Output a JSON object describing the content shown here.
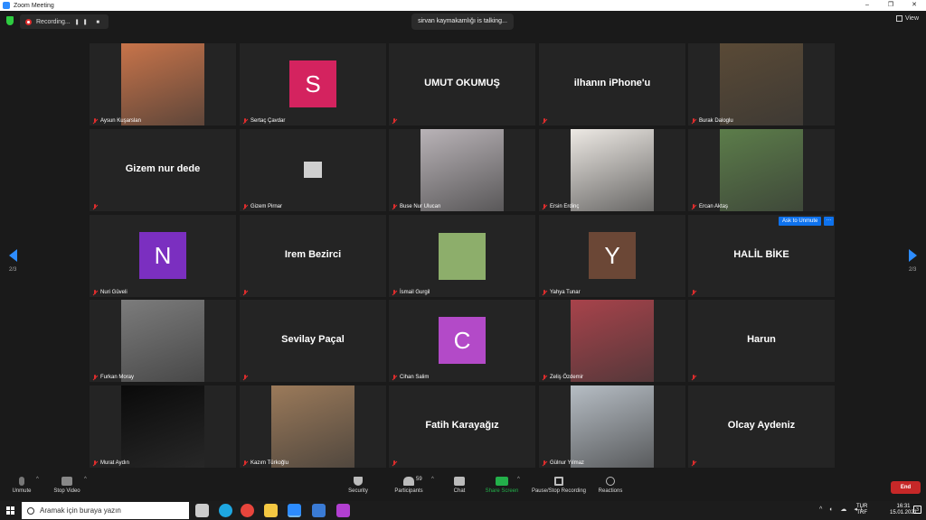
{
  "window": {
    "title": "Zoom Meeting",
    "controls": [
      "–",
      "❐",
      "✕"
    ]
  },
  "topbar": {
    "recording_label": "Recording...",
    "talking_label": "sirvan kaymakamlığı is talking...",
    "view_label": "View"
  },
  "tiles": [
    {
      "name": "Aysun Kuşarslan",
      "kind": "photo",
      "color": "#c8744a"
    },
    {
      "name": "Sertaç Çavdar",
      "kind": "avatar",
      "letter": "S",
      "color": "#d4235f"
    },
    {
      "name": "",
      "kind": "text",
      "display": "UMUT OKUMUŞ"
    },
    {
      "name": "",
      "kind": "text",
      "display": "ilhanın iPhone'u"
    },
    {
      "name": "Burak Daloglu",
      "kind": "photo",
      "color": "#5a4a36"
    },
    {
      "name": "",
      "kind": "text",
      "display": "Gizem nur dede"
    },
    {
      "name": "Gizem Pirnar",
      "kind": "small",
      "color": "#cfcfcf"
    },
    {
      "name": "Buse Nur Ulucan",
      "kind": "photo",
      "color": "#b9b3b7"
    },
    {
      "name": "Ersin Erdinç",
      "kind": "photo",
      "color": "#ede9e4"
    },
    {
      "name": "Ercan Aktaş",
      "kind": "photo",
      "color": "#5c7d4a"
    },
    {
      "name": "Nuri Güveli",
      "kind": "avatar",
      "letter": "N",
      "color": "#7b2fc0"
    },
    {
      "name": "",
      "kind": "text",
      "display": "Irem Bezirci"
    },
    {
      "name": "İsmail Gurgil",
      "kind": "small",
      "color": "#8dae6b"
    },
    {
      "name": "Yahya Tunar",
      "kind": "avatar",
      "letter": "Y",
      "color": "#6b4736"
    },
    {
      "name": "",
      "kind": "text",
      "display": "HALİL BİKE"
    },
    {
      "name": "Furkan Moray",
      "kind": "photo",
      "color": "#7c7c7c"
    },
    {
      "name": "",
      "kind": "text",
      "display": "Sevilay Paçal"
    },
    {
      "name": "Cihan Salim",
      "kind": "avatar",
      "letter": "C",
      "color": "#b34ac8"
    },
    {
      "name": "Zeliş Özdemir",
      "kind": "photo",
      "color": "#a8434b"
    },
    {
      "name": "",
      "kind": "text",
      "display": "Harun"
    },
    {
      "name": "Murat Aydın",
      "kind": "photo",
      "color": "#0a0a0a"
    },
    {
      "name": "Kazım Türkoğlu",
      "kind": "photo",
      "color": "#9b7a5a"
    },
    {
      "name": "",
      "kind": "text",
      "display": "Fatih Karayağız"
    },
    {
      "name": "Gülnur Yılmaz",
      "kind": "photo",
      "color": "#b6bdc4"
    },
    {
      "name": "",
      "kind": "text",
      "display": "Olcay Aydeniz"
    }
  ],
  "overlay": {
    "ask_unmute": "Ask to Unmute",
    "more": "···"
  },
  "pagination": {
    "left": "2/3",
    "right": "2/3"
  },
  "toolbar": {
    "unmute": "Unmute",
    "stop_video": "Stop Video",
    "security": "Security",
    "participants": "Participants",
    "participants_count": "59",
    "chat": "Chat",
    "share_screen": "Share Screen",
    "pause_recording": "Pause/Stop Recording",
    "reactions": "Reactions",
    "end": "End"
  },
  "taskbar": {
    "search_placeholder": "Aramak için buraya yazın",
    "lang_top": "TUR",
    "lang_bottom": "TRF",
    "time": "16:31",
    "date": "15.01.2021",
    "notifications": "3",
    "apps": [
      {
        "name": "task-view",
        "color": "#cccccc"
      },
      {
        "name": "edge",
        "color": "#1ea7e1"
      },
      {
        "name": "chrome",
        "color": "#e8453c"
      },
      {
        "name": "file-explorer",
        "color": "#f4c842"
      },
      {
        "name": "zoom",
        "color": "#2d8cff"
      },
      {
        "name": "photos",
        "color": "#3a7bd5"
      },
      {
        "name": "app-drop",
        "color": "#b23fd1"
      }
    ]
  }
}
